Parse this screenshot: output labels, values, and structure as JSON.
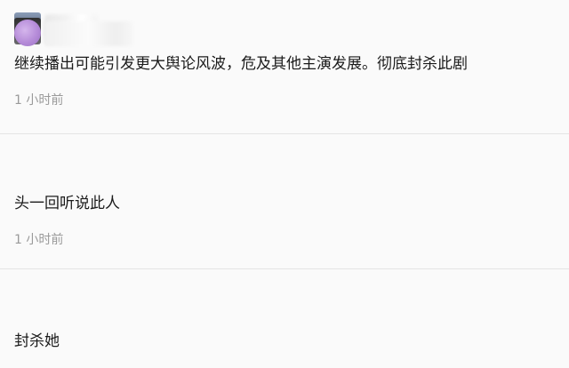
{
  "comments": [
    {
      "avatar": "user-avatar",
      "text": "继续播出可能引发更大舆论风波，危及其他主演发展。彻底封杀此剧",
      "time": "1 小时前"
    },
    {
      "avatar": "user-avatar",
      "text": "头一回听说此人",
      "time": "1 小时前"
    },
    {
      "avatar": "user-avatar",
      "text": "封杀她"
    }
  ]
}
